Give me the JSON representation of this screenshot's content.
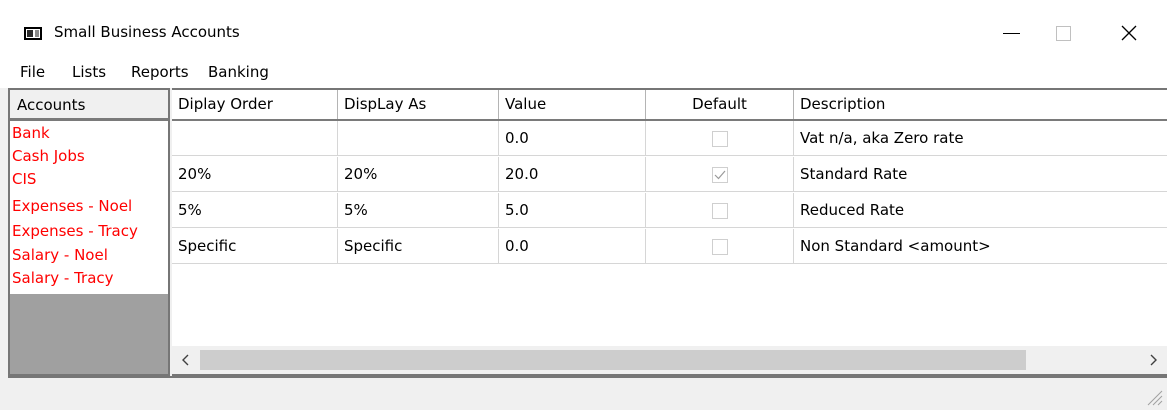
{
  "window": {
    "title": "Small Business Accounts",
    "icons": [
      "app-icon",
      "minimize-icon",
      "maximize-icon",
      "close-icon"
    ]
  },
  "menu": [
    "File",
    "Lists",
    "Reports",
    "Banking"
  ],
  "accounts": {
    "header": "Accounts",
    "items": [
      "Bank",
      "Cash Jobs",
      "CIS",
      "Expenses - Noel",
      "Expenses - Tracy",
      "Salary - Noel",
      "Salary - Tracy"
    ],
    "item_color": "#ff0000"
  },
  "grid": {
    "columns": [
      "Diplay Order",
      "DispLay As",
      "Value",
      "Default",
      "Description"
    ],
    "rows": [
      {
        "display_order": "",
        "display_as": "",
        "value": "0.0",
        "default": false,
        "description": "Vat n/a, aka Zero rate"
      },
      {
        "display_order": "20%",
        "display_as": "20%",
        "value": "20.0",
        "default": true,
        "description": "Standard Rate"
      },
      {
        "display_order": "5%",
        "display_as": "5%",
        "value": "5.0",
        "default": false,
        "description": "Reduced Rate"
      },
      {
        "display_order": "Specific",
        "display_as": "Specific",
        "value": "0.0",
        "default": false,
        "description": "Non Standard <amount>"
      }
    ],
    "scroll_icons": [
      "chevron-left-icon",
      "chevron-right-icon"
    ]
  },
  "statusbar": {
    "text": "",
    "icons": [
      "resize-grip-icon"
    ]
  }
}
